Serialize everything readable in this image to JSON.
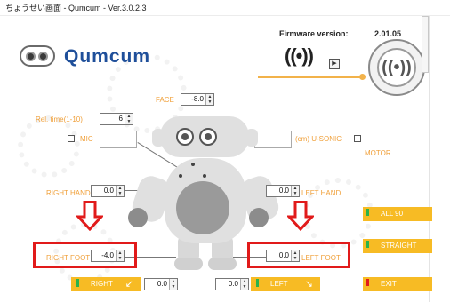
{
  "window": {
    "title": "ちょうせい画面 - Qumcum - Ver.3.0.2.3"
  },
  "brand": {
    "name": "Qumcum"
  },
  "firmware": {
    "label": "Firmware version:",
    "value": "2.01.05"
  },
  "header": {
    "signal_glyph": "((•))",
    "play_glyph": "▶",
    "bt_glyph": "((•))"
  },
  "face": {
    "label": "FACE",
    "value": "-8.0"
  },
  "rel_time": {
    "label": "Rel. time(1-10)",
    "value": "6"
  },
  "mic": {
    "label": "MIC"
  },
  "usonic": {
    "label": "(cm) U-SONIC"
  },
  "motor": {
    "label": "MOTOR"
  },
  "right_hand": {
    "label": "RIGHT HAND",
    "value": "0.0"
  },
  "left_hand": {
    "label": "LEFT HAND",
    "value": "0.0"
  },
  "right_foot": {
    "label": "RIGHT FOOT",
    "value": "-4.0"
  },
  "left_foot": {
    "label": "LEFT FOOT",
    "value": "0.0"
  },
  "buttons": {
    "all90": {
      "label": "ALL 90",
      "indicator": "#2bb24c"
    },
    "straight": {
      "label": "STRAIGHT",
      "indicator": "#2bb24c"
    },
    "exit": {
      "label": "EXIT",
      "indicator": "#e11a1a"
    },
    "right": {
      "label": "RIGHT",
      "indicator": "#2bb24c",
      "value": "0.0"
    },
    "left": {
      "label": "LEFT",
      "indicator": "#2bb24c",
      "value": "0.0"
    }
  },
  "colors": {
    "accent": "#f7bb24",
    "label": "#f0a03a",
    "highlight": "#e11a1a",
    "brand": "#1f4f9a"
  },
  "icons": {
    "logo": "qumcum-robot-face-icon",
    "signal": "broadcast-icon",
    "play": "play-icon",
    "bluetooth": "connection-icon"
  }
}
